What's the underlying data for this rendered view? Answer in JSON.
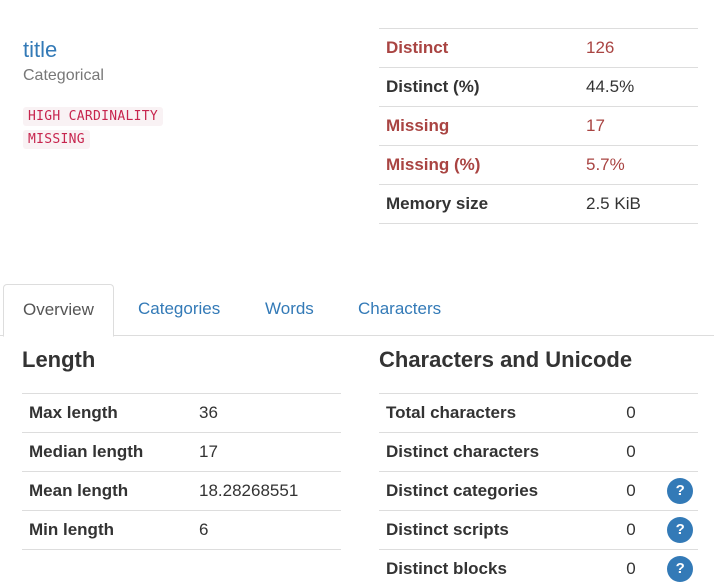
{
  "variable": {
    "name": "title",
    "type": "Categorical",
    "alerts": [
      "HIGH CARDINALITY",
      "MISSING"
    ]
  },
  "summary": [
    {
      "key": "Distinct",
      "value": "126",
      "alert": true
    },
    {
      "key": "Distinct (%)",
      "value": "44.5%",
      "alert": false
    },
    {
      "key": "Missing",
      "value": "17",
      "alert": true
    },
    {
      "key": "Missing (%)",
      "value": "5.7%",
      "alert": true
    },
    {
      "key": "Memory size",
      "value": "2.5 KiB",
      "alert": false
    }
  ],
  "tabs": [
    "Overview",
    "Categories",
    "Words",
    "Characters"
  ],
  "active_tab": "Overview",
  "length": {
    "title": "Length",
    "rows": [
      {
        "key": "Max length",
        "value": "36"
      },
      {
        "key": "Median length",
        "value": "17"
      },
      {
        "key": "Mean length",
        "value": "18.28268551"
      },
      {
        "key": "Min length",
        "value": "6"
      }
    ]
  },
  "unicode": {
    "title": "Characters and Unicode",
    "rows": [
      {
        "key": "Total characters",
        "value": "0",
        "help": false
      },
      {
        "key": "Distinct characters",
        "value": "0",
        "help": false
      },
      {
        "key": "Distinct categories",
        "value": "0",
        "help": true
      },
      {
        "key": "Distinct scripts",
        "value": "0",
        "help": true
      },
      {
        "key": "Distinct blocks",
        "value": "0",
        "help": true
      }
    ],
    "help_label": "?"
  },
  "colors": {
    "link": "#337ab7",
    "alert_text": "#a94442",
    "badge_text": "#c7254e",
    "badge_bg": "#f9f2f4"
  }
}
